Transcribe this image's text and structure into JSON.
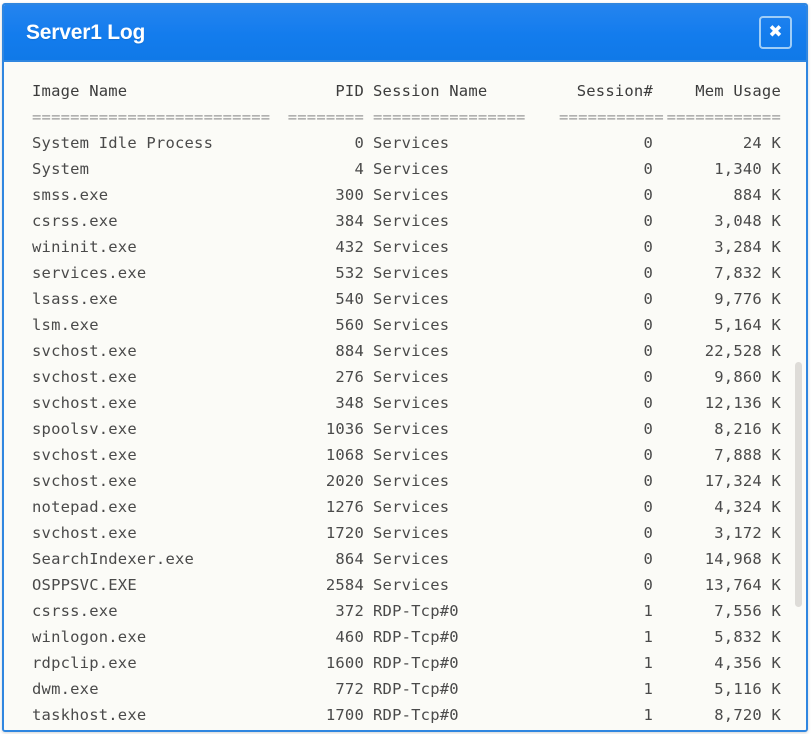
{
  "window": {
    "title": "Server1 Log",
    "close_label": "✖",
    "accent_color": "#137ced",
    "border_color": "#2f86e0",
    "body_background": "#fbfbf7",
    "text_color": "#4a4a4a"
  },
  "table": {
    "headers": {
      "image_name": "Image Name",
      "pid": "PID",
      "session_name": "Session Name",
      "session_number": "Session#",
      "mem_usage": "Mem Usage"
    },
    "separators": {
      "image_name": "=========================",
      "pid": "========",
      "session_name": "================",
      "session_number": "===========",
      "mem_usage": "============"
    },
    "rows": [
      {
        "image_name": "System Idle Process",
        "pid": "0",
        "session_name": "Services",
        "session_number": "0",
        "mem_usage": "24 K"
      },
      {
        "image_name": "System",
        "pid": "4",
        "session_name": "Services",
        "session_number": "0",
        "mem_usage": "1,340 K"
      },
      {
        "image_name": "smss.exe",
        "pid": "300",
        "session_name": "Services",
        "session_number": "0",
        "mem_usage": "884 K"
      },
      {
        "image_name": "csrss.exe",
        "pid": "384",
        "session_name": "Services",
        "session_number": "0",
        "mem_usage": "3,048 K"
      },
      {
        "image_name": "wininit.exe",
        "pid": "432",
        "session_name": "Services",
        "session_number": "0",
        "mem_usage": "3,284 K"
      },
      {
        "image_name": "services.exe",
        "pid": "532",
        "session_name": "Services",
        "session_number": "0",
        "mem_usage": "7,832 K"
      },
      {
        "image_name": "lsass.exe",
        "pid": "540",
        "session_name": "Services",
        "session_number": "0",
        "mem_usage": "9,776 K"
      },
      {
        "image_name": "lsm.exe",
        "pid": "560",
        "session_name": "Services",
        "session_number": "0",
        "mem_usage": "5,164 K"
      },
      {
        "image_name": "svchost.exe",
        "pid": "884",
        "session_name": "Services",
        "session_number": "0",
        "mem_usage": "22,528 K"
      },
      {
        "image_name": "svchost.exe",
        "pid": "276",
        "session_name": "Services",
        "session_number": "0",
        "mem_usage": "9,860 K"
      },
      {
        "image_name": "svchost.exe",
        "pid": "348",
        "session_name": "Services",
        "session_number": "0",
        "mem_usage": "12,136 K"
      },
      {
        "image_name": "spoolsv.exe",
        "pid": "1036",
        "session_name": "Services",
        "session_number": "0",
        "mem_usage": "8,216 K"
      },
      {
        "image_name": "svchost.exe",
        "pid": "1068",
        "session_name": "Services",
        "session_number": "0",
        "mem_usage": "7,888 K"
      },
      {
        "image_name": "svchost.exe",
        "pid": "2020",
        "session_name": "Services",
        "session_number": "0",
        "mem_usage": "17,324 K"
      },
      {
        "image_name": "notepad.exe",
        "pid": "1276",
        "session_name": "Services",
        "session_number": "0",
        "mem_usage": "4,324 K"
      },
      {
        "image_name": "svchost.exe",
        "pid": "1720",
        "session_name": "Services",
        "session_number": "0",
        "mem_usage": "3,172 K"
      },
      {
        "image_name": "SearchIndexer.exe",
        "pid": "864",
        "session_name": "Services",
        "session_number": "0",
        "mem_usage": "14,968 K"
      },
      {
        "image_name": "OSPPSVC.EXE",
        "pid": "2584",
        "session_name": "Services",
        "session_number": "0",
        "mem_usage": "13,764 K"
      },
      {
        "image_name": "csrss.exe",
        "pid": "372",
        "session_name": "RDP-Tcp#0",
        "session_number": "1",
        "mem_usage": "7,556 K"
      },
      {
        "image_name": "winlogon.exe",
        "pid": "460",
        "session_name": "RDP-Tcp#0",
        "session_number": "1",
        "mem_usage": "5,832 K"
      },
      {
        "image_name": "rdpclip.exe",
        "pid": "1600",
        "session_name": "RDP-Tcp#0",
        "session_number": "1",
        "mem_usage": "4,356 K"
      },
      {
        "image_name": "dwm.exe",
        "pid": "772",
        "session_name": "RDP-Tcp#0",
        "session_number": "1",
        "mem_usage": "5,116 K"
      },
      {
        "image_name": "taskhost.exe",
        "pid": "1700",
        "session_name": "RDP-Tcp#0",
        "session_number": "1",
        "mem_usage": "8,720 K"
      }
    ]
  }
}
